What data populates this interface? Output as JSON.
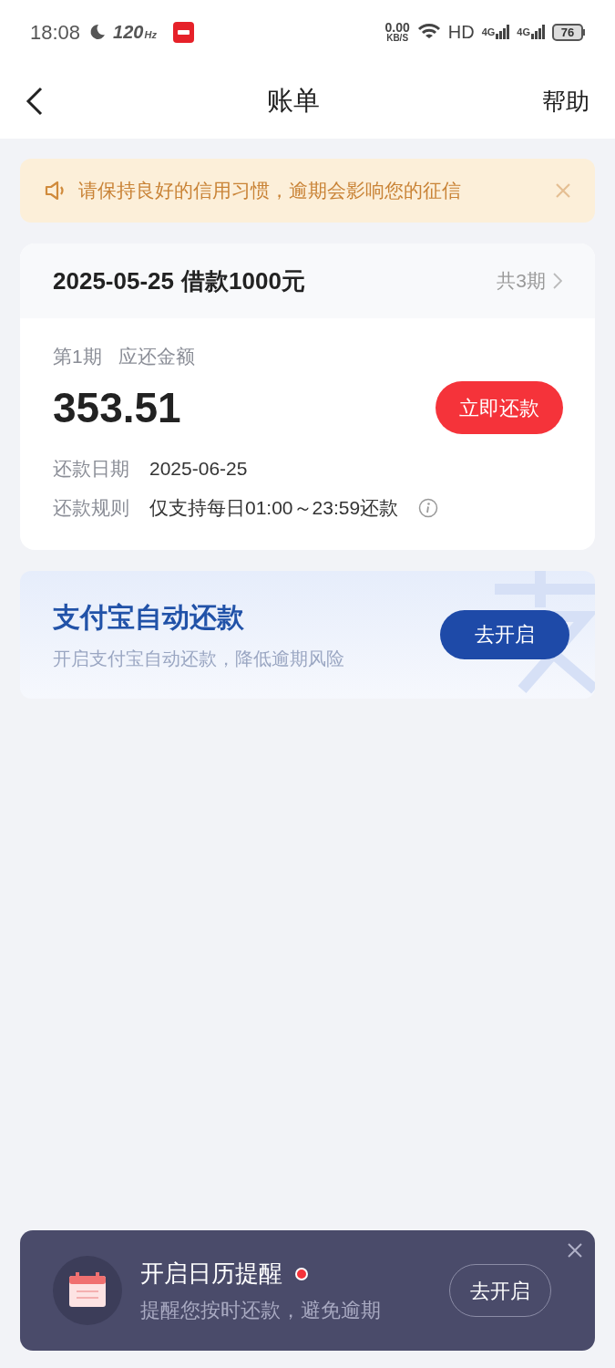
{
  "status_bar": {
    "time": "18:08",
    "refresh_rate": "120",
    "refresh_unit": "Hz",
    "net_speed": "0.00",
    "net_unit": "KB/S",
    "hd_label": "HD",
    "signals": [
      {
        "label": "4G"
      },
      {
        "label": "4G"
      }
    ],
    "battery": "76"
  },
  "nav": {
    "title": "账单",
    "action": "帮助"
  },
  "notice": {
    "text": "请保持良好的信用习惯，逾期会影响您的征信"
  },
  "loan": {
    "date": "2025-05-25",
    "title": "借款1000元",
    "periods": "共3期",
    "installment": "第1期",
    "amount_label": "应还金额",
    "amount": "353.51",
    "pay_button": "立即还款",
    "details": [
      {
        "label": "还款日期",
        "value": "2025-06-25",
        "info": false
      },
      {
        "label": "还款规则",
        "value": "仅支持每日01:00～23:59还款",
        "info": true
      }
    ]
  },
  "autopay": {
    "title": "支付宝自动还款",
    "subtitle": "开启支付宝自动还款，降低逾期风险",
    "button": "去开启"
  },
  "reminder": {
    "title": "开启日历提醒",
    "unread": true,
    "subtitle": "提醒您按时还款，避免逾期",
    "button": "去开启"
  }
}
